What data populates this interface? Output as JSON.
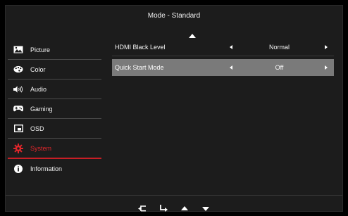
{
  "header": {
    "title": "Mode - Standard"
  },
  "sidebar": {
    "items": [
      {
        "label": "Picture",
        "icon": "picture-icon"
      },
      {
        "label": "Color",
        "icon": "palette-icon"
      },
      {
        "label": "Audio",
        "icon": "speaker-icon"
      },
      {
        "label": "Gaming",
        "icon": "gamepad-icon"
      },
      {
        "label": "OSD",
        "icon": "osd-icon"
      },
      {
        "label": "System",
        "icon": "gear-icon",
        "active": true
      },
      {
        "label": "Information",
        "icon": "info-icon"
      }
    ]
  },
  "settings": {
    "rows": [
      {
        "name": "HDMI Black Level",
        "value": "Normal"
      },
      {
        "name": "Quick Start Mode",
        "value": "Off",
        "selected": true
      }
    ]
  },
  "nav": {
    "buttons": [
      "back-icon",
      "enter-icon",
      "up-arrow-icon",
      "down-arrow-icon"
    ]
  },
  "colors": {
    "accent": "#e0262b",
    "selected_row": "#7a7a7a",
    "panel": "#1c1c1c"
  }
}
